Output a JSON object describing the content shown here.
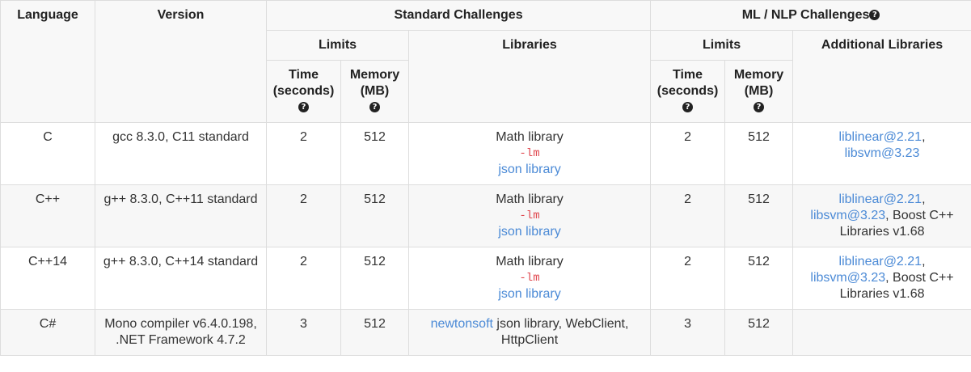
{
  "header": {
    "language": "Language",
    "version": "Version",
    "standard": "Standard Challenges",
    "ml": "ML / NLP Challenges",
    "limits": "Limits",
    "libraries": "Libraries",
    "additional_libraries": "Additional Libraries",
    "time": "Time (seconds)",
    "memory": "Memory (MB)",
    "help_glyph": "?"
  },
  "rows": [
    {
      "language": "C",
      "version": "gcc 8.3.0, C11 standard",
      "std_time": "2",
      "std_memory": "512",
      "lib_math": "Math library",
      "lib_flag": "-lm",
      "lib_json": "json library",
      "ml_time": "2",
      "ml_memory": "512",
      "ml_lib1": "liblinear@2.21",
      "ml_sep1": ",",
      "ml_lib2": "libsvm@3.23",
      "ml_extra": ""
    },
    {
      "language": "C++",
      "version": "g++ 8.3.0, C++11 standard",
      "std_time": "2",
      "std_memory": "512",
      "lib_math": "Math library",
      "lib_flag": "-lm",
      "lib_json": "json library",
      "ml_time": "2",
      "ml_memory": "512",
      "ml_lib1": "liblinear@2.21",
      "ml_sep1": ",",
      "ml_lib2": "libsvm@3.23",
      "ml_extra": ", Boost C++ Libraries v1.68"
    },
    {
      "language": "C++14",
      "version": "g++ 8.3.0, C++14 standard",
      "std_time": "2",
      "std_memory": "512",
      "lib_math": "Math library",
      "lib_flag": "-lm",
      "lib_json": "json library",
      "ml_time": "2",
      "ml_memory": "512",
      "ml_lib1": "liblinear@2.21",
      "ml_sep1": ",",
      "ml_lib2": "libsvm@3.23",
      "ml_extra": ", Boost C++ Libraries v1.68"
    },
    {
      "language": "C#",
      "version": "Mono compiler v6.4.0.198, .NET Framework 4.7.2",
      "std_time": "3",
      "std_memory": "512",
      "lib_link": "newtonsoft",
      "lib_rest": " json library, WebClient, HttpClient",
      "ml_time": "3",
      "ml_memory": "512"
    }
  ]
}
